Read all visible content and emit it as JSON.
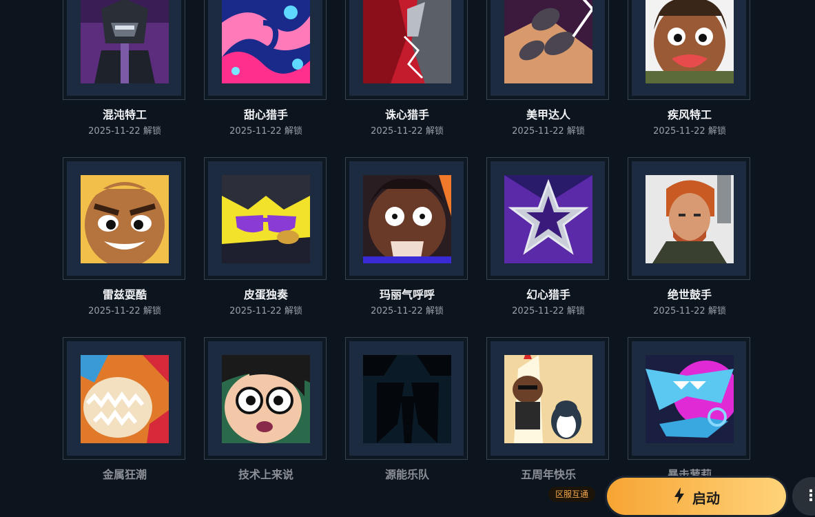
{
  "cards": [
    {
      "name": "混沌特工",
      "date": "2025-11-22 解锁"
    },
    {
      "name": "甜心猎手",
      "date": "2025-11-22 解锁"
    },
    {
      "name": "诛心猎手",
      "date": "2025-11-22 解锁"
    },
    {
      "name": "美甲达人",
      "date": "2025-11-22 解锁"
    },
    {
      "name": "疾风特工",
      "date": "2025-11-22 解锁"
    },
    {
      "name": "雷兹耍酷",
      "date": "2025-11-22 解锁"
    },
    {
      "name": "皮蛋独奏",
      "date": "2025-11-22 解锁"
    },
    {
      "name": "玛丽气呼呼",
      "date": "2025-11-22 解锁"
    },
    {
      "name": "幻心猎手",
      "date": "2025-11-22 解锁"
    },
    {
      "name": "绝世鼓手",
      "date": "2025-11-22 解锁"
    },
    {
      "name": "金属狂潮",
      "date": ""
    },
    {
      "name": "技术上来说",
      "date": ""
    },
    {
      "name": "源能乐队",
      "date": ""
    },
    {
      "name": "五周年快乐",
      "date": ""
    },
    {
      "name": "暴击萝莉",
      "date": ""
    }
  ],
  "footer": {
    "region_badge": "区服互通",
    "launch_label": "启动",
    "launch_icon": "lightning-bolt-icon",
    "more_icon": "more-options-icon"
  },
  "colors": {
    "background": "#0c141d",
    "frame_fill": "#1c2b3f",
    "launch_gradient_start": "#f7a533",
    "launch_gradient_end": "#ffd37a",
    "badge_text": "#f2a64a"
  }
}
